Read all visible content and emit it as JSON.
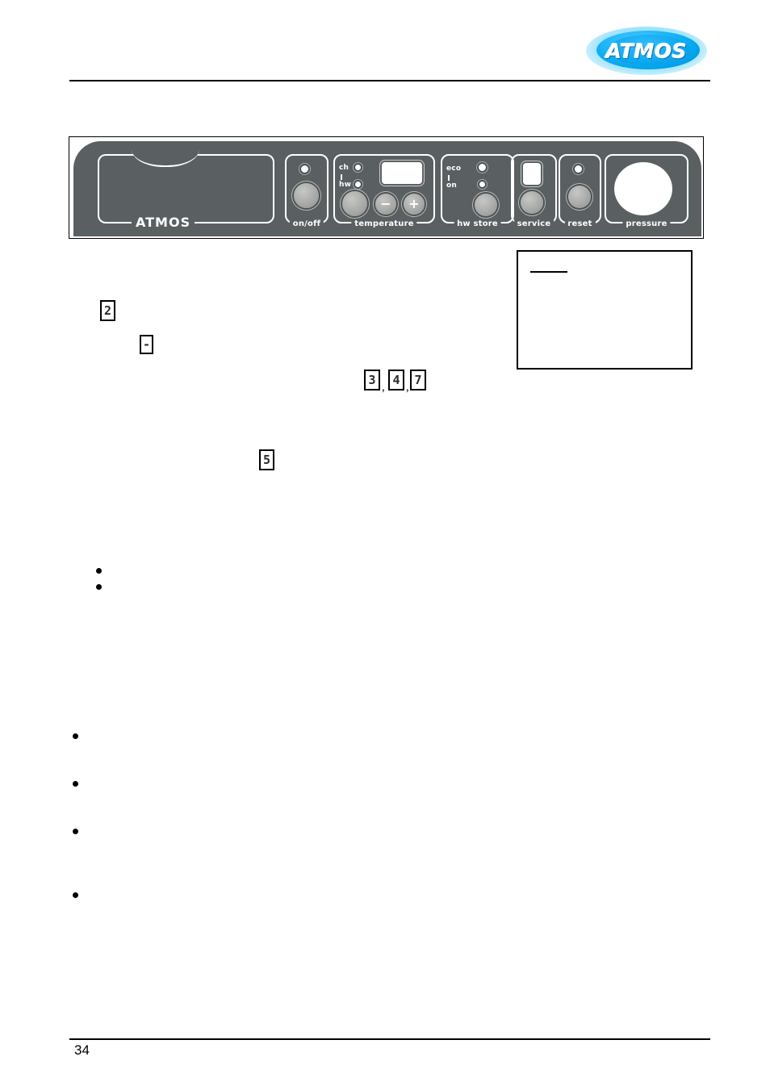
{
  "document": {
    "page_number": "34",
    "brand_logo_text": "ATMOS"
  },
  "figure": {
    "name": "boiler-control-panel",
    "panel_brand_text": "ATMOS",
    "panel_color": "#5a6062",
    "outline_color": "#ffffff",
    "groups": [
      {
        "id": "brand",
        "label": "ATMOS"
      },
      {
        "id": "onoff",
        "label": "on/off"
      },
      {
        "id": "temp",
        "label": "temperature"
      },
      {
        "id": "hwstore",
        "label": "hw store"
      },
      {
        "id": "service",
        "label": "service"
      },
      {
        "id": "reset",
        "label": "reset"
      },
      {
        "id": "press",
        "label": "pressure"
      }
    ],
    "temperature_indicators": [
      {
        "id": "ch",
        "label": "ch"
      },
      {
        "id": "hw",
        "label": "hw"
      }
    ],
    "hw_store_indicators": [
      {
        "id": "eco",
        "label": "eco"
      },
      {
        "id": "on",
        "label": "on"
      }
    ],
    "temperature_buttons": {
      "minus_label": "−",
      "plus_label": "+"
    }
  },
  "body": {
    "markers": {
      "marker_2": "2",
      "marker_dash": "-",
      "marker_group_a": [
        "3",
        "4",
        "7"
      ],
      "marker_group_separator": ",",
      "marker_5": "5"
    }
  }
}
